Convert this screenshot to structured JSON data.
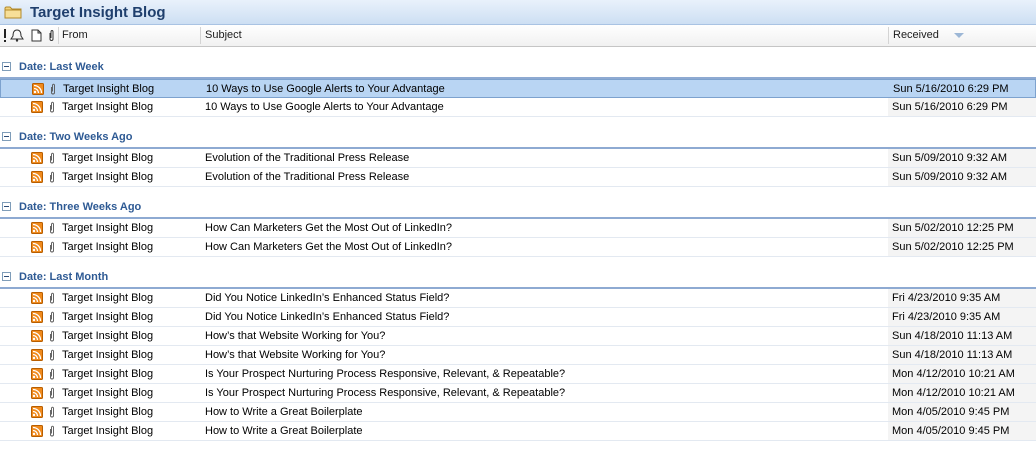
{
  "window": {
    "title": "Target Insight Blog"
  },
  "columns": {
    "from": "From",
    "subject": "Subject",
    "received": "Received"
  },
  "groups": [
    {
      "label": "Date: Last Week",
      "rows": [
        {
          "from": "Target Insight Blog",
          "subject": "10 Ways to Use Google Alerts to Your Advantage",
          "received": "Sun 5/16/2010 6:29 PM",
          "selected": true
        },
        {
          "from": "Target Insight Blog",
          "subject": "10 Ways to Use Google Alerts to Your Advantage",
          "received": "Sun 5/16/2010 6:29 PM"
        }
      ]
    },
    {
      "label": "Date: Two Weeks Ago",
      "rows": [
        {
          "from": "Target Insight Blog",
          "subject": "Evolution of the Traditional Press Release",
          "received": "Sun 5/09/2010 9:32 AM"
        },
        {
          "from": "Target Insight Blog",
          "subject": "Evolution of the Traditional Press Release",
          "received": "Sun 5/09/2010 9:32 AM"
        }
      ]
    },
    {
      "label": "Date: Three Weeks Ago",
      "rows": [
        {
          "from": "Target Insight Blog",
          "subject": "How Can Marketers Get the Most Out of LinkedIn?",
          "received": "Sun 5/02/2010 12:25 PM"
        },
        {
          "from": "Target Insight Blog",
          "subject": "How Can Marketers Get the Most Out of LinkedIn?",
          "received": "Sun 5/02/2010 12:25 PM"
        }
      ]
    },
    {
      "label": "Date: Last Month",
      "rows": [
        {
          "from": "Target Insight Blog",
          "subject": "Did You Notice LinkedIn’s Enhanced Status Field?",
          "received": "Fri 4/23/2010 9:35 AM"
        },
        {
          "from": "Target Insight Blog",
          "subject": "Did You Notice LinkedIn’s Enhanced Status Field?",
          "received": "Fri 4/23/2010 9:35 AM"
        },
        {
          "from": "Target Insight Blog",
          "subject": "How’s that Website Working for You?",
          "received": "Sun 4/18/2010 11:13 AM"
        },
        {
          "from": "Target Insight Blog",
          "subject": "How’s that Website Working for You?",
          "received": "Sun 4/18/2010 11:13 AM"
        },
        {
          "from": "Target Insight Blog",
          "subject": "Is Your Prospect Nurturing Process Responsive, Relevant, & Repeatable?",
          "received": "Mon 4/12/2010 10:21 AM"
        },
        {
          "from": "Target Insight Blog",
          "subject": "Is Your Prospect Nurturing Process Responsive, Relevant, & Repeatable?",
          "received": "Mon 4/12/2010 10:21 AM"
        },
        {
          "from": "Target Insight Blog",
          "subject": "How to Write a Great Boilerplate",
          "received": "Mon 4/05/2010 9:45 PM"
        },
        {
          "from": "Target Insight Blog",
          "subject": "How to Write a Great Boilerplate",
          "received": "Mon 4/05/2010 9:45 PM"
        }
      ]
    }
  ],
  "icons": {
    "folder": "folder-icon",
    "rss": "rss-feed-icon",
    "attachment": "paperclip-icon",
    "collapse": "collapse-minus-icon"
  },
  "colors": {
    "accent": "#2e5a94",
    "selection": "#b9d5f3",
    "rss": "#f08a1c"
  }
}
